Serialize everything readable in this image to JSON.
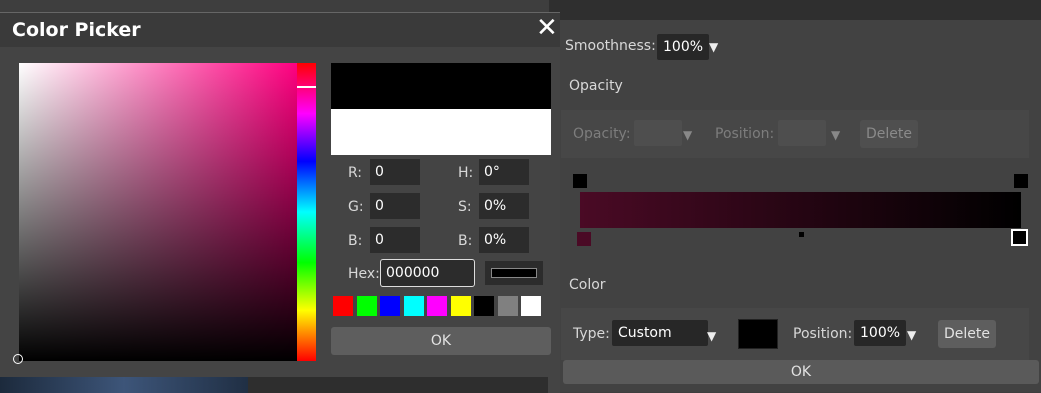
{
  "gradient_editor": {
    "smoothness_label": "Smoothness:",
    "smoothness_value": "100%",
    "opacity_section": "Opacity",
    "opacity_label": "Opacity:",
    "opacity_value": "",
    "opacity_position_label": "Position:",
    "opacity_position_value": "",
    "opacity_delete": "Delete",
    "color_section": "Color",
    "type_label": "Type:",
    "type_value": "Custom",
    "color_position_label": "Position:",
    "color_position_value": "100%",
    "color_delete": "Delete",
    "ok": "OK",
    "gradient_start_color": "#4a0a25",
    "gradient_end_color": "#000000"
  },
  "color_picker": {
    "title": "Color Picker",
    "close_glyph": "✕",
    "r_label": "R:",
    "r_value": "0",
    "g_label": "G:",
    "g_value": "0",
    "b_label": "B:",
    "b_value": "0",
    "h_label": "H:",
    "h_value": "0°",
    "s_label": "S:",
    "s_value": "0%",
    "br_label": "B:",
    "br_value": "0%",
    "hex_label": "Hex:",
    "hex_value": "000000",
    "new_color": "#000000",
    "current_color": "#ffffff",
    "swatches": [
      "#ff0000",
      "#00ff00",
      "#0000ff",
      "#00ffff",
      "#ff00ff",
      "#ffff00",
      "#000000",
      "#808080",
      "#ffffff"
    ],
    "ok": "OK"
  }
}
